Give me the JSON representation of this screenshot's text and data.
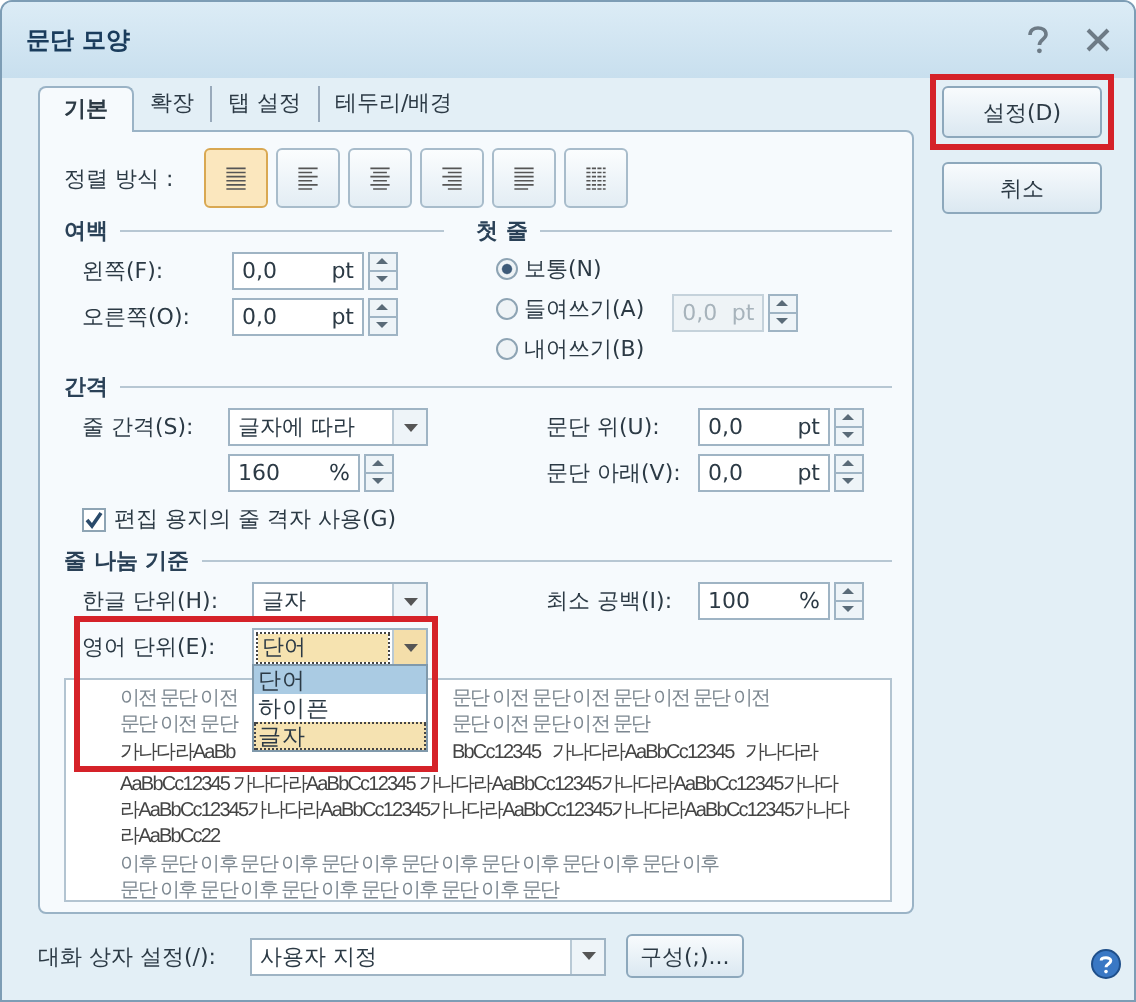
{
  "window": {
    "title": "문단 모양"
  },
  "tabs": [
    {
      "label": "기본",
      "selected": true
    },
    {
      "label": "확장",
      "selected": false
    },
    {
      "label": "탭 설정",
      "selected": false
    },
    {
      "label": "테두리/배경",
      "selected": false
    }
  ],
  "alignment": {
    "label": "정렬 방식 :",
    "options": [
      {
        "kind": "justify",
        "selected": true
      },
      {
        "kind": "left",
        "selected": false
      },
      {
        "kind": "center",
        "selected": false
      },
      {
        "kind": "right",
        "selected": false
      },
      {
        "kind": "distribute",
        "selected": false
      },
      {
        "kind": "divide",
        "selected": false
      }
    ]
  },
  "margins": {
    "title": "여백",
    "fields": [
      {
        "label": "왼쪽(F):",
        "value": "0,0",
        "unit": "pt"
      },
      {
        "label": "오른쪽(O):",
        "value": "0,0",
        "unit": "pt"
      }
    ]
  },
  "first_line": {
    "title": "첫 줄",
    "options": [
      {
        "label": "보통(N)",
        "selected": true
      },
      {
        "label": "들여쓰기(A)",
        "selected": false
      },
      {
        "label": "내어쓰기(B)",
        "selected": false
      }
    ],
    "field": {
      "value": "0,0",
      "unit": "pt",
      "disabled": true
    }
  },
  "spacing": {
    "title": "간격",
    "line_spacing": {
      "label": "줄 간격(S):",
      "value": "글자에 따라"
    },
    "line_value": {
      "value": "160",
      "unit": "%"
    },
    "before": {
      "label": "문단 위(U):",
      "value": "0,0",
      "unit": "pt"
    },
    "after": {
      "label": "문단 아래(V):",
      "value": "0,0",
      "unit": "pt"
    },
    "grid": {
      "label": "편집 용지의 줄 격자 사용(G)",
      "checked": true
    }
  },
  "line_break": {
    "title": "줄 나눔 기준",
    "korean": {
      "label": "한글 단위(H):",
      "value": "글자"
    },
    "min_space": {
      "label": "최소 공백(I):",
      "value": "100",
      "unit": "%"
    },
    "english": {
      "label": "영어 단위(E):",
      "value": "단어",
      "highlighted": true,
      "expanded": true,
      "options": [
        {
          "label": "단어",
          "selected": true,
          "focused": false
        },
        {
          "label": "하이픈",
          "selected": false,
          "focused": false
        },
        {
          "label": "글자",
          "selected": false,
          "focused": true
        }
      ]
    }
  },
  "preview": {
    "lines": [
      {
        "kind": "before",
        "segments": [
          "이전 문단 이전",
          "문단 이전 문단 이전 문단 이전 문단 이전"
        ]
      },
      {
        "kind": "before",
        "segments": [
          "문단 이전 문단",
          "문단 이전 문단 이전 문단"
        ]
      },
      {
        "kind": "current",
        "segments": [
          "가나다라AaBb",
          "BbCc12345   가나다라AaBbCc12345   가나다라"
        ]
      },
      {
        "kind": "current",
        "segments": [
          "AaBbCc12345 가나다라AaBbCc12345 가나다라AaBbCc12345가나다라AaBbCc12345가나다"
        ]
      },
      {
        "kind": "current",
        "segments": [
          "라AaBbCc12345가나다라AaBbCc12345가나다라AaBbCc12345가나다라AaBbCc12345가나다"
        ]
      },
      {
        "kind": "current",
        "segments": [
          "라AaBbCc22"
        ]
      },
      {
        "kind": "after",
        "segments": [
          "이후 문단 이후 문단 이후 문단 이후 문단 이후 문단 이후 문단 이후 문단 이후"
        ]
      },
      {
        "kind": "after",
        "segments": [
          "문단 이후 문단 이후 문단 이후 문단 이후 문단 이후 문단"
        ]
      }
    ]
  },
  "footer": {
    "label": "대화 상자 설정(/):",
    "value": "사용자 지정",
    "button": "구성(;)..."
  },
  "buttons": [
    {
      "label": "설정(D)",
      "highlighted": true
    },
    {
      "label": "취소",
      "highlighted": false
    }
  ]
}
